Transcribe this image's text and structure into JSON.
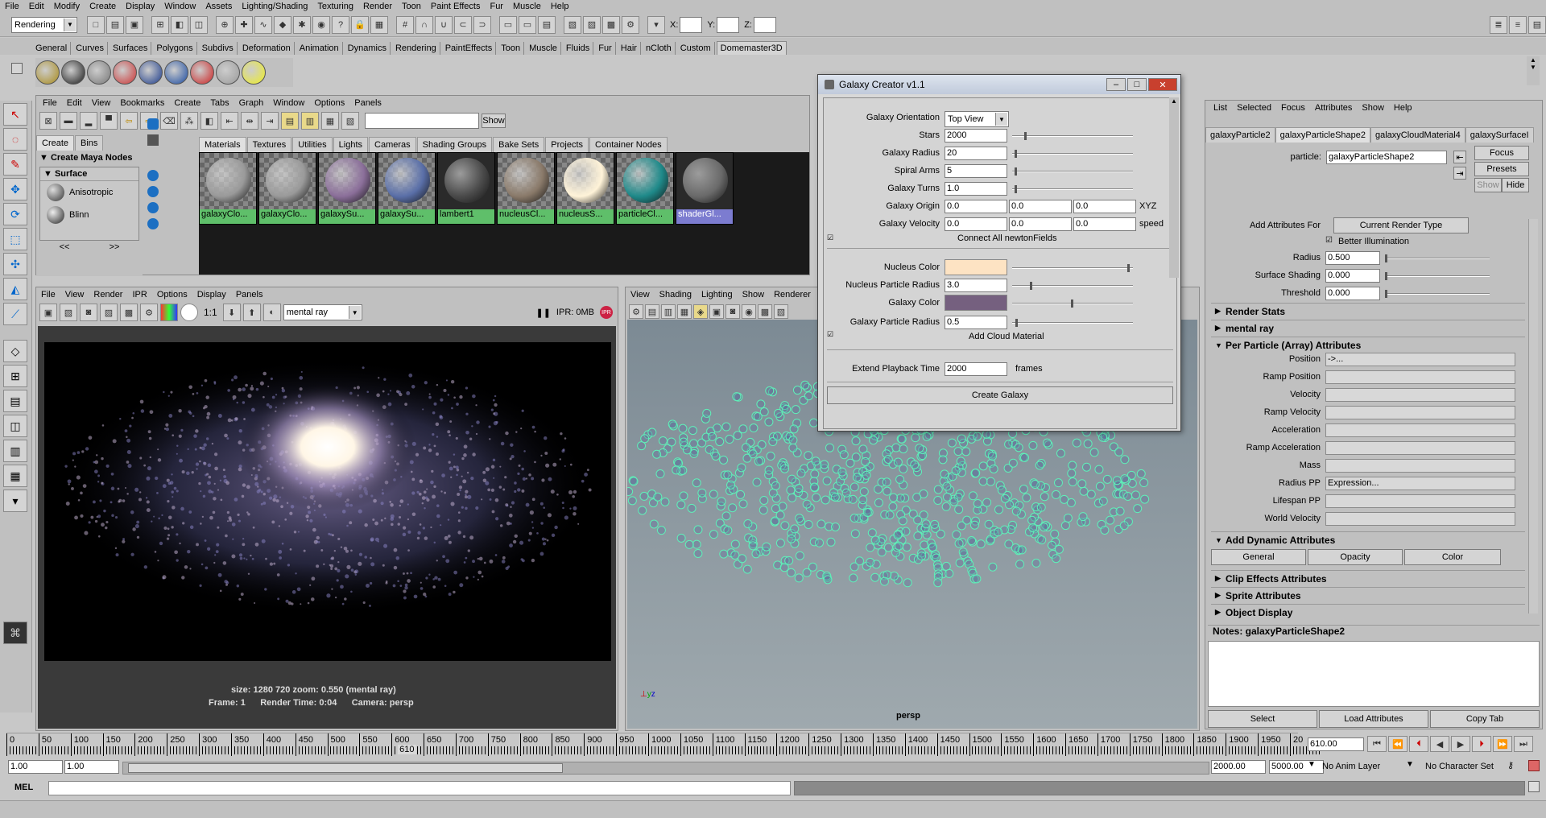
{
  "menubar": [
    "File",
    "Edit",
    "Modify",
    "Create",
    "Display",
    "Window",
    "Assets",
    "Lighting/Shading",
    "Texturing",
    "Render",
    "Toon",
    "Paint Effects",
    "Fur",
    "Muscle",
    "Help"
  ],
  "statusline": {
    "mode": "Rendering",
    "x_label": "X:",
    "y_label": "Y:",
    "z_label": "Z:"
  },
  "shelf_tabs": [
    "General",
    "Curves",
    "Surfaces",
    "Polygons",
    "Subdivs",
    "Deformation",
    "Animation",
    "Dynamics",
    "Rendering",
    "PaintEffects",
    "Toon",
    "Muscle",
    "Fluids",
    "Fur",
    "Hair",
    "nCloth",
    "Custom",
    "Domemaster3D"
  ],
  "shelf_active": "Domemaster3D",
  "hypershade": {
    "menu": [
      "File",
      "Edit",
      "View",
      "Bookmarks",
      "Create",
      "Tabs",
      "Graph",
      "Window",
      "Options",
      "Panels"
    ],
    "show_label": "Show",
    "left_tabs": [
      "Create",
      "Bins"
    ],
    "create_nodes": "Create Maya Nodes",
    "surface_label": "Surface",
    "nodes": [
      "Anisotropic",
      "Blinn"
    ],
    "nav_prev": "<<",
    "nav_next": ">>",
    "tabs": [
      "Materials",
      "Textures",
      "Utilities",
      "Lights",
      "Cameras",
      "Shading Groups",
      "Bake Sets",
      "Projects",
      "Container Nodes"
    ],
    "swatches": [
      {
        "label": "galaxyClo...",
        "ball": "#9a9a9a",
        "checker": true
      },
      {
        "label": "galaxyClo...",
        "ball": "#9a9a9a",
        "checker": true
      },
      {
        "label": "galaxySu...",
        "ball": "#8b6f9a",
        "checker": true
      },
      {
        "label": "galaxySu...",
        "ball": "#5a6fa8",
        "checker": true
      },
      {
        "label": "lambert1",
        "ball": "#4a4a4a",
        "checker": false
      },
      {
        "label": "nucleusCl...",
        "ball": "#8a7a6a",
        "checker": true
      },
      {
        "label": "nucleusS...",
        "ball": "#fff3d8",
        "checker": true
      },
      {
        "label": "particleCl...",
        "ball": "#1f8a8a",
        "checker": true
      },
      {
        "label": "shaderGl...",
        "ball": "#6a6a6a",
        "checker": false
      }
    ]
  },
  "render_view": {
    "menu": [
      "File",
      "View",
      "Render",
      "IPR",
      "Options",
      "Display",
      "Panels"
    ],
    "ratio": "1:1",
    "renderer": "mental ray",
    "ipr": "IPR: 0MB",
    "info_line1": "size: 1280  720 zoom: 0.550     (mental ray)",
    "info_line2": "Frame: 1      Render Time: 0:04      Camera: persp"
  },
  "viewport": {
    "menu": [
      "View",
      "Shading",
      "Lighting",
      "Show",
      "Renderer"
    ],
    "camera": "persp"
  },
  "galaxy_dialog": {
    "title": "Galaxy Creator v1.1",
    "orientation_label": "Galaxy Orientation",
    "orientation_value": "Top View",
    "stars_label": "Stars",
    "stars_value": "2000",
    "stars_level": 0.1,
    "radius_label": "Galaxy Radius",
    "radius_value": "20",
    "radius_level": 0.02,
    "arms_label": "Spiral Arms",
    "arms_value": "5",
    "arms_level": 0.02,
    "turns_label": "Galaxy Turns",
    "turns_value": "1.0",
    "turns_level": 0.02,
    "origin_label": "Galaxy Origin",
    "origin_values": [
      "0.0",
      "0.0",
      "0.0"
    ],
    "origin_unit": "XYZ",
    "velocity_label": "Galaxy Velocity",
    "velocity_values": [
      "0.0",
      "0.0",
      "0.0"
    ],
    "velocity_unit": "speed",
    "connect_label": "Connect All newtonFields",
    "nucleus_color_label": "Nucleus Color",
    "nucleus_color": "#fde3c3",
    "nucleus_color_level": 0.98,
    "nucleus_radius_label": "Nucleus Particle Radius",
    "nucleus_radius_value": "3.0",
    "nucleus_radius_level": 0.15,
    "galaxy_color_label": "Galaxy Color",
    "galaxy_color": "#75607f",
    "galaxy_color_level": 0.5,
    "galaxy_radius_label": "Galaxy Particle Radius",
    "galaxy_radius_value": "0.5",
    "galaxy_radius_level": 0.03,
    "cloud_label": "Add Cloud Material",
    "playback_label": "Extend Playback Time",
    "playback_value": "2000",
    "playback_unit": "frames",
    "create_button": "Create Galaxy"
  },
  "attribute_editor": {
    "menu": [
      "List",
      "Selected",
      "Focus",
      "Attributes",
      "Show",
      "Help"
    ],
    "tabs": [
      "galaxyParticle2",
      "galaxyParticleShape2",
      "galaxyCloudMaterial4",
      "galaxySurfaceI"
    ],
    "particle_label": "particle:",
    "particle_value": "galaxyParticleShape2",
    "focus": "Focus",
    "presets": "Presets",
    "show": "Show",
    "hide": "Hide",
    "add_attr_label": "Add Attributes For",
    "render_type_btn": "Current Render Type",
    "better_illum": "Better Illumination",
    "radius_label": "Radius",
    "radius_value": "0.500",
    "surface_shading_label": "Surface Shading",
    "surface_shading_value": "0.000",
    "threshold_label": "Threshold",
    "threshold_value": "0.000",
    "sections": [
      "Render Stats",
      "mental ray",
      "Per Particle (Array) Attributes"
    ],
    "pp_rows": [
      {
        "label": "Position",
        "value": "->..."
      },
      {
        "label": "Ramp Position",
        "value": ""
      },
      {
        "label": "Velocity",
        "value": ""
      },
      {
        "label": "Ramp Velocity",
        "value": ""
      },
      {
        "label": "Acceleration",
        "value": ""
      },
      {
        "label": "Ramp Acceleration",
        "value": ""
      },
      {
        "label": "Mass",
        "value": ""
      },
      {
        "label": "Radius PP",
        "value": "Expression..."
      },
      {
        "label": "Lifespan PP",
        "value": ""
      },
      {
        "label": "World Velocity",
        "value": ""
      }
    ],
    "dynamic_section": "Add Dynamic Attributes",
    "dyn_buttons": [
      "General",
      "Opacity",
      "Color"
    ],
    "bottom_sections": [
      "Clip Effects Attributes",
      "Sprite Attributes",
      "Object Display"
    ],
    "notes_label": "Notes:  galaxyParticleShape2",
    "buttons": [
      "Select",
      "Load Attributes",
      "Copy Tab"
    ]
  },
  "timeline": {
    "ticks": [
      "0",
      "50",
      "100",
      "150",
      "200",
      "250",
      "300",
      "350",
      "400",
      "450",
      "500",
      "550",
      "600",
      "650",
      "700",
      "750",
      "800",
      "850",
      "900",
      "950",
      "1000",
      "1050",
      "1100",
      "1150",
      "1200",
      "1250",
      "1300",
      "1350",
      "1400",
      "1450",
      "1500",
      "1550",
      "1600",
      "1650",
      "1700",
      "1750",
      "1800",
      "1850",
      "1900",
      "1950",
      "20"
    ],
    "current_frame_marker": "610",
    "current_frame": "610.00",
    "range_start": "1.00",
    "range_start2": "1.00",
    "range_end": "2000.00",
    "range_end2": "5000.00",
    "anim_layer": "No Anim Layer",
    "char_set": "No Character Set"
  },
  "command_line": {
    "label": "MEL"
  }
}
